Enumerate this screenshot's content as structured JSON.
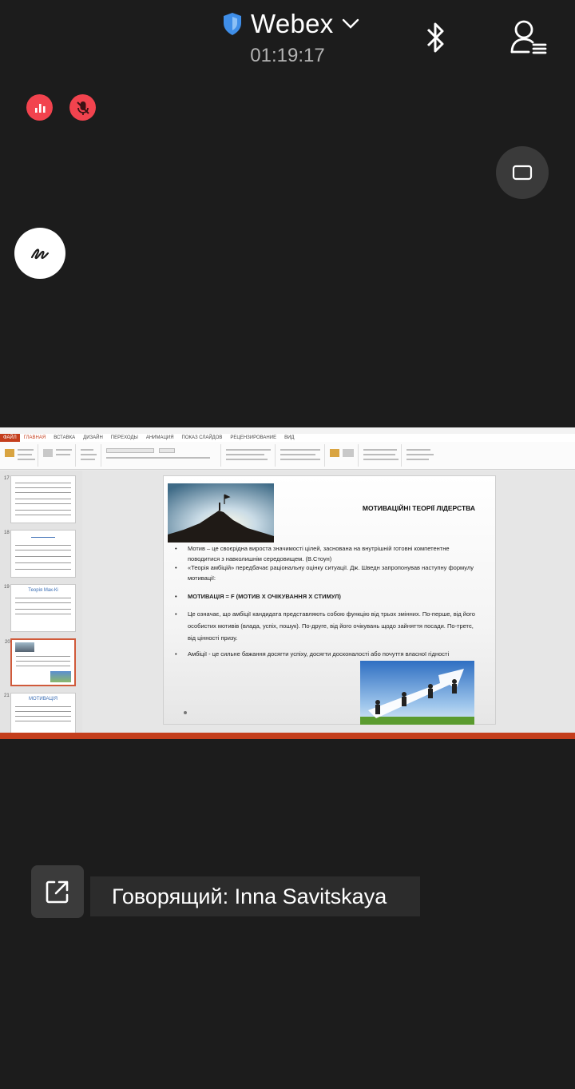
{
  "header": {
    "app_name": "Webex",
    "timer": "01:19:17"
  },
  "icons": {
    "shield": "shield-icon",
    "chevron": "chevron-down-icon",
    "bluetooth": "bluetooth-icon",
    "participants": "participants-icon",
    "audio": "audio-level-icon",
    "mic_muted": "mic-muted-icon",
    "layout": "layout-icon",
    "annotate": "annotate-icon",
    "share": "share-out-icon"
  },
  "colors": {
    "accent_blue": "#4a90e2",
    "muted_red": "#f2434e",
    "ppt_red": "#c43e1c"
  },
  "shared_screen": {
    "menu": {
      "file": "ФАЙЛ",
      "tabs": [
        "ГЛАВНАЯ",
        "ВСТАВКА",
        "ДИЗАЙН",
        "ПЕРЕХОДЫ",
        "АНИМАЦИЯ",
        "ПОКАЗ СЛАЙДОВ",
        "РЕЦЕНЗИРОВАНИЕ",
        "ВИД"
      ]
    },
    "thumbs": [
      {
        "num": "17",
        "title": ""
      },
      {
        "num": "18",
        "title": ""
      },
      {
        "num": "19",
        "title": "Теорія Мак-Кі"
      },
      {
        "num": "20",
        "title": ""
      },
      {
        "num": "21",
        "title": "МОТИВАЦІЯ"
      }
    ],
    "slide": {
      "title": "МОТИВАЦІЙНІ ТЕОРІЇ ЛІДЕРСТВА",
      "bullets": [
        "Мотив – це своєрідна вироста значимості цілей, заснована на внутрішній готовні компетентне поводитися з навколишнім середовищем. (В.Стоун)",
        "«Теорія амбіцій» передбачає раціональну оцінку ситуації. Дж. Шведн запропонував наступну формулу мотивації:",
        "МОТИВАЦІЯ = F (МОТИВ Х ОЧІКУВАННЯ Х СТИМУЛ)",
        "Це означає, що амбіції кандидата представляють собою функцію від трьох змінних. По-перше, від його особистих мотивів (влада, успіх, пошук). По-друге, від його очікувань щодо зайняття посади. По-третє, від цінності призу.",
        "Амбіції - це сильне бажання досягти успіху, досягти досконалості або почуття власної гідності"
      ]
    }
  },
  "speaker": {
    "label": "Говорящий: Inna Savitskaya"
  }
}
